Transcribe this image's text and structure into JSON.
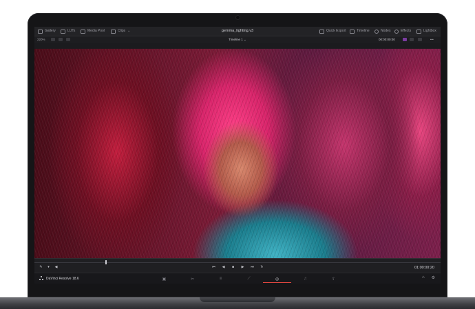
{
  "app": {
    "project_title": "gemma_lighting.v3",
    "brand_label": "DaVinci Resolve 18.6"
  },
  "topbar": {
    "left_items": [
      {
        "label": "Gallery",
        "icon": "gallery-icon"
      },
      {
        "label": "LUTs",
        "icon": "luts-icon"
      },
      {
        "label": "Media Pool",
        "icon": "media-pool-icon"
      },
      {
        "label": "Clips",
        "icon": "clips-icon"
      }
    ],
    "right_items": [
      {
        "label": "Quick Export",
        "icon": "export-icon"
      },
      {
        "label": "Timeline",
        "icon": "timeline-icon"
      },
      {
        "label": "Nodes",
        "icon": "nodes-icon"
      },
      {
        "label": "Effects",
        "icon": "effects-icon"
      },
      {
        "label": "Lightbox",
        "icon": "lightbox-icon"
      }
    ]
  },
  "viewer_bar": {
    "zoom": "220%",
    "timeline_name": "Timeline 1",
    "timecode": "00:00:00:00"
  },
  "transport": {
    "timecode": "01:00:00:20",
    "controls": [
      "skip-back",
      "step-back",
      "stop",
      "play",
      "skip-forward",
      "loop"
    ]
  },
  "pages": [
    {
      "name": "media-page-icon",
      "active": false
    },
    {
      "name": "cut-page-icon",
      "active": false
    },
    {
      "name": "edit-page-icon",
      "active": false
    },
    {
      "name": "fusion-page-icon",
      "active": false
    },
    {
      "name": "color-page-icon",
      "active": true
    },
    {
      "name": "fairlight-page-icon",
      "active": false
    },
    {
      "name": "deliver-page-icon",
      "active": false
    }
  ],
  "colors": {
    "accent": "#e0463f",
    "ui_dark": "#1b1b1e"
  }
}
